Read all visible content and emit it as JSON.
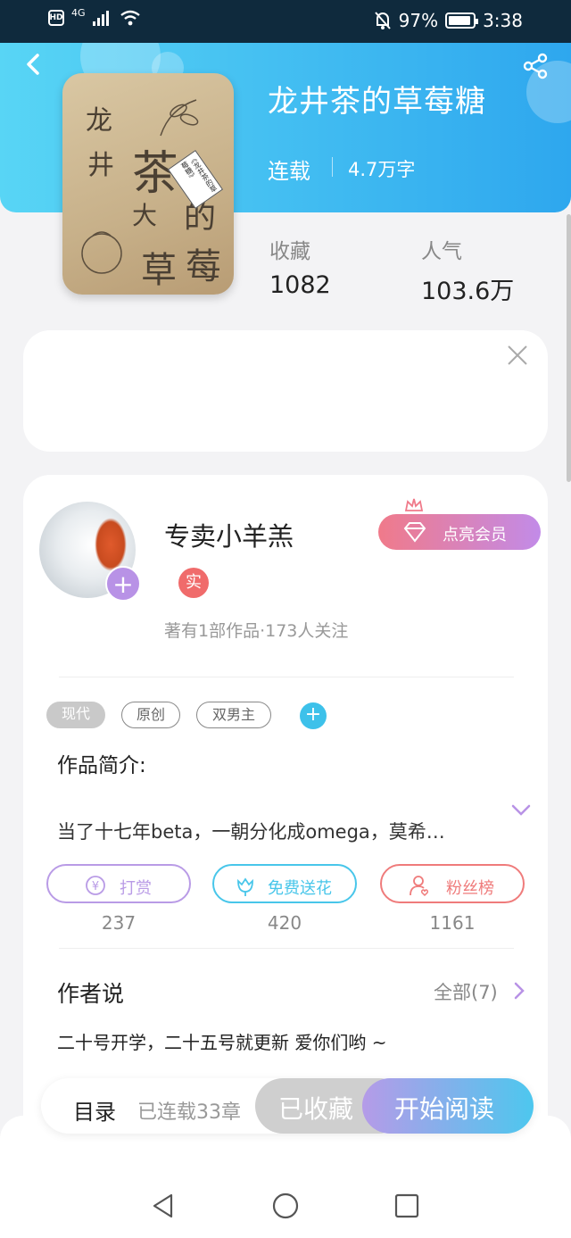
{
  "status_bar": {
    "hd": "HD",
    "network": "4G",
    "battery_percent": "97%",
    "time": "3:38"
  },
  "book": {
    "title": "龙井茶的草莓糖",
    "status": "连载",
    "word_count": "4.7万字",
    "cover_chars": [
      "龙",
      "井",
      "茶",
      "的",
      "大",
      "草",
      "莓"
    ],
    "cover_tag": "《龙井茶的草莓糖》"
  },
  "stats": {
    "favorites_label": "收藏",
    "favorites_value": "1082",
    "popularity_label": "人气",
    "popularity_value": "103.6万"
  },
  "author": {
    "name": "专卖小羊羔",
    "verified_badge": "实",
    "meta": "著有1部作品·173人关注",
    "vip_label": "点亮会员"
  },
  "tags": [
    "现代",
    "原创",
    "双男主"
  ],
  "intro": {
    "title": "作品简介:",
    "text": "当了十七年beta，一朝分化成omega，莫希…"
  },
  "actions": [
    {
      "label": "打赏",
      "count": "237",
      "color": "#b99be6"
    },
    {
      "label": "免费送花",
      "count": "420",
      "color": "#48c6ea"
    },
    {
      "label": "粉丝榜",
      "count": "1161",
      "color": "#ef7b7b"
    }
  ],
  "author_says": {
    "title": "作者说",
    "see_all": "全部(7)",
    "note": "二十号开学，二十五号就更新 爱你们哟 ~"
  },
  "bottom_bar": {
    "toc_label": "目录",
    "toc_count": "已连载33章",
    "favorite_label": "已收藏",
    "read_label": "开始阅读"
  },
  "colors": {
    "header_start": "#58d5f5",
    "header_end": "#2ea7ee",
    "vip_start": "#f07a8a",
    "vip_end": "#c28be8",
    "accent_purple": "#b892e6",
    "accent_blue": "#3dc1ea"
  }
}
